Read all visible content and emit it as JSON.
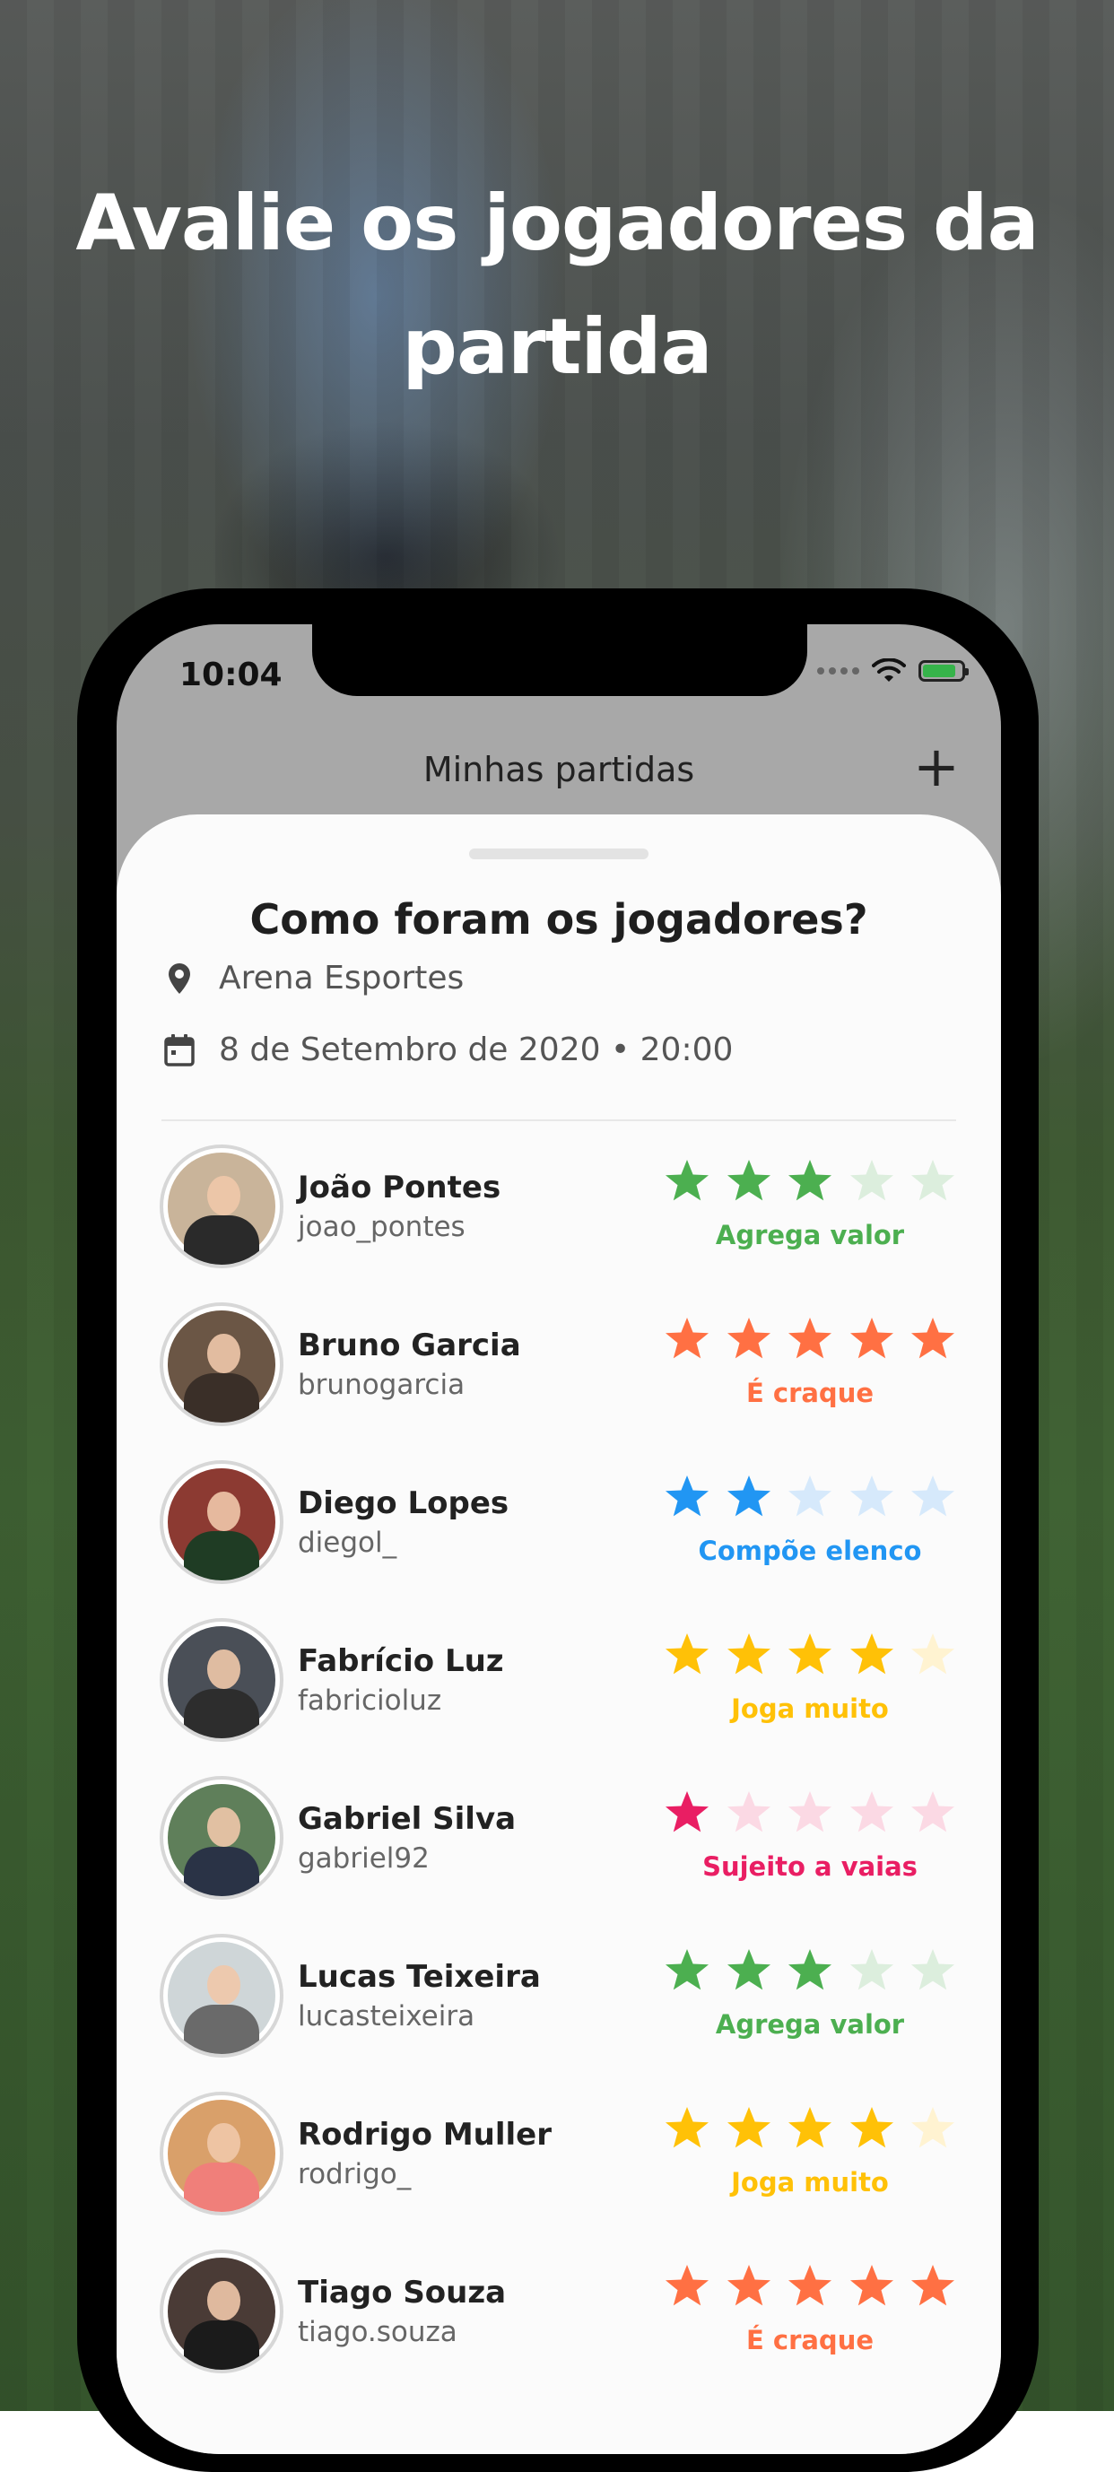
{
  "headline": {
    "line1": "Avalie os jogadores da",
    "line2": "partida"
  },
  "status_bar": {
    "time": "10:04",
    "icons": [
      "signal-dots-icon",
      "wifi-icon",
      "battery-charging-icon"
    ]
  },
  "top_bar": {
    "title": "Minhas partidas",
    "add_icon": "plus-icon"
  },
  "sheet": {
    "title": "Como foram os jogadores?",
    "location": {
      "icon": "location-pin-icon",
      "text": "Arena Esportes"
    },
    "date": {
      "icon": "calendar-icon",
      "text": "8 de Setembro de 2020 • 20:00"
    }
  },
  "players": [
    {
      "name": "João Pontes",
      "username": "joao_pontes",
      "rating": 3,
      "label": "Agrega valor",
      "color": "#4caf50",
      "faded": "#dceedd",
      "avatar_bg": "#c9b49a",
      "avatar_body": "#2a2a2a"
    },
    {
      "name": "Bruno Garcia",
      "username": "brunogarcia",
      "rating": 5,
      "label": "É craque",
      "color": "#ff7043",
      "faded": "#ffe0d6",
      "avatar_bg": "#6b5645",
      "avatar_body": "#3a2f28"
    },
    {
      "name": "Diego Lopes",
      "username": "diegol_",
      "rating": 2,
      "label": "Compõe elenco",
      "color": "#2196f3",
      "faded": "#d6e9fb",
      "avatar_bg": "#8c3a32",
      "avatar_body": "#1f3c24"
    },
    {
      "name": "Fabrício Luz",
      "username": "fabricioluz",
      "rating": 4,
      "label": "Joga muito",
      "color": "#ffc107",
      "faded": "#fff3d1",
      "avatar_bg": "#4a4f57",
      "avatar_body": "#2d2d2d"
    },
    {
      "name": "Gabriel Silva",
      "username": "gabriel92",
      "rating": 1,
      "label": "Sujeito a vaias",
      "color": "#e91e63",
      "faded": "#fbd9e4",
      "avatar_bg": "#5f7f5a",
      "avatar_body": "#2a3346"
    },
    {
      "name": "Lucas Teixeira",
      "username": "lucasteixeira",
      "rating": 3,
      "label": "Agrega valor",
      "color": "#4caf50",
      "faded": "#dceedd",
      "avatar_bg": "#cfd6d8",
      "avatar_body": "#6a6a6a"
    },
    {
      "name": "Rodrigo Muller",
      "username": "rodrigo_",
      "rating": 4,
      "label": "Joga muito",
      "color": "#ffc107",
      "faded": "#fff3d1",
      "avatar_bg": "#d9a06a",
      "avatar_body": "#f07f7a"
    },
    {
      "name": "Tiago Souza",
      "username": "tiago.souza",
      "rating": 5,
      "label": "É craque",
      "color": "#ff7043",
      "faded": "#ffe0d6",
      "avatar_bg": "#4a3b36",
      "avatar_body": "#1b1b1b"
    }
  ]
}
